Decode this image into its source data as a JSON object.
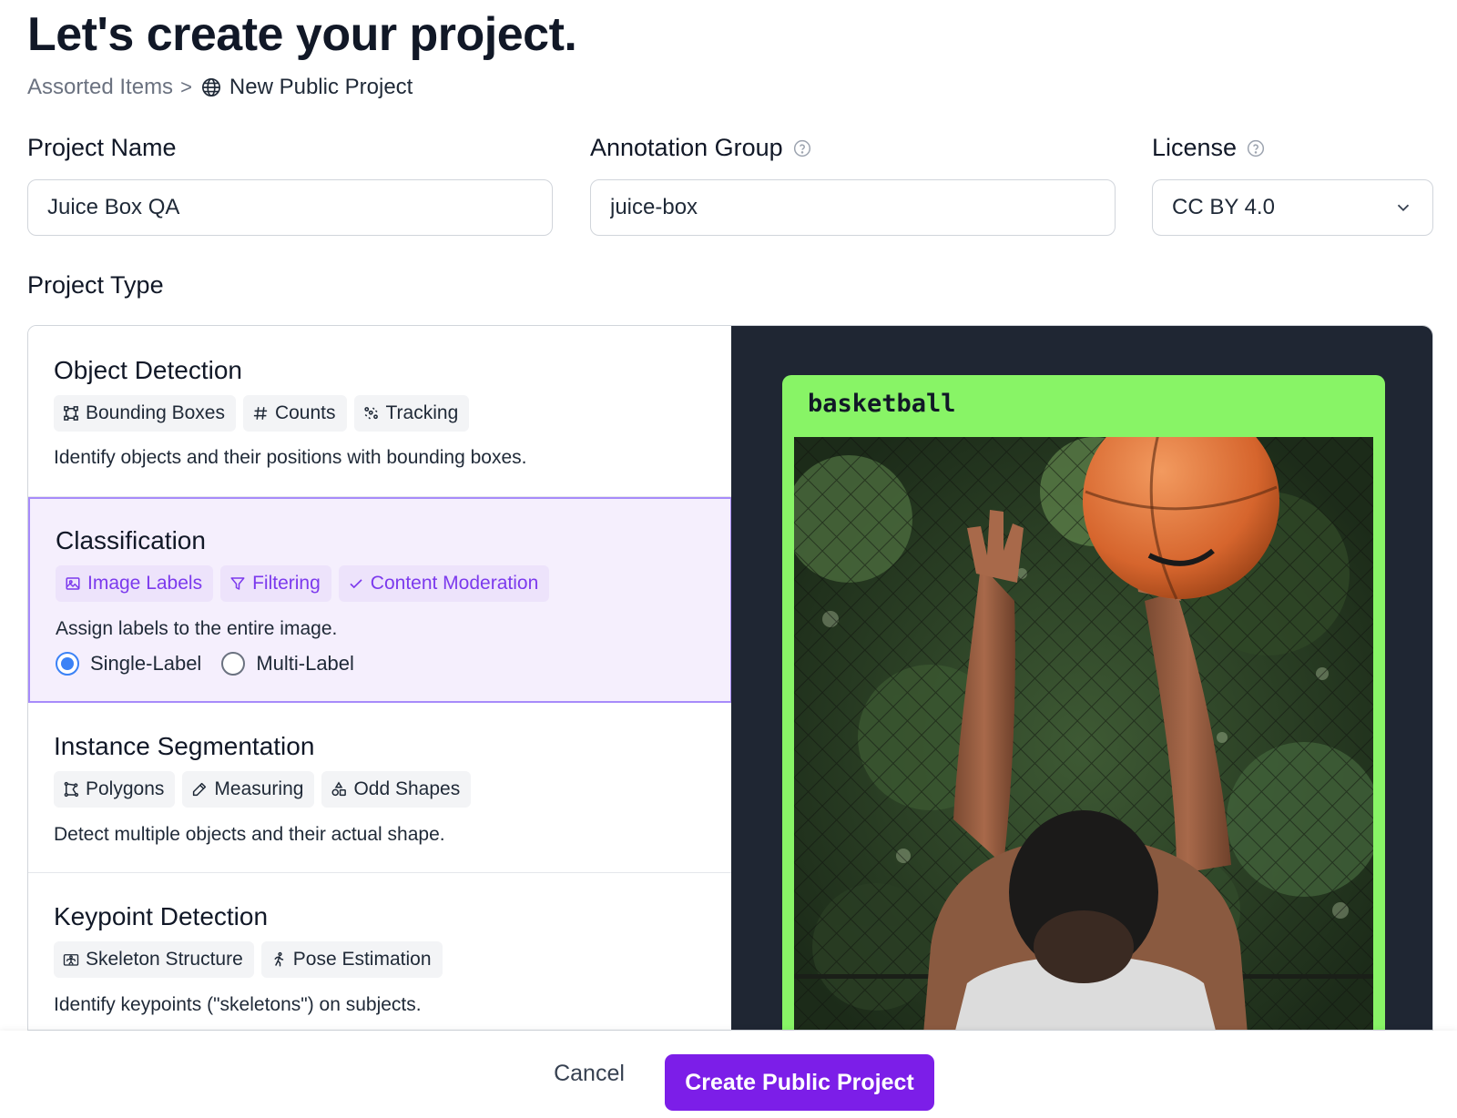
{
  "header": {
    "title": "Let's create your project.",
    "breadcrumb": {
      "parent": "Assorted Items",
      "separator": ">",
      "current": "New Public Project"
    }
  },
  "form": {
    "project_name": {
      "label": "Project Name",
      "value": "Juice Box QA"
    },
    "annotation_group": {
      "label": "Annotation Group",
      "value": "juice-box"
    },
    "license": {
      "label": "License",
      "value": "CC BY 4.0"
    }
  },
  "project_type": {
    "label": "Project Type",
    "types": [
      {
        "title": "Object Detection",
        "chips": [
          {
            "label": "Bounding Boxes",
            "icon": "bounding-box-icon"
          },
          {
            "label": "Counts",
            "icon": "hash-icon"
          },
          {
            "label": "Tracking",
            "icon": "tracking-icon"
          }
        ],
        "description": "Identify objects and their positions with bounding boxes."
      },
      {
        "title": "Classification",
        "selected": true,
        "chips": [
          {
            "label": "Image Labels",
            "icon": "image-icon"
          },
          {
            "label": "Filtering",
            "icon": "filter-icon"
          },
          {
            "label": "Content Moderation",
            "icon": "check-icon"
          }
        ],
        "description": "Assign labels to the entire image.",
        "options": [
          {
            "label": "Single-Label",
            "checked": true
          },
          {
            "label": "Multi-Label",
            "checked": false
          }
        ]
      },
      {
        "title": "Instance Segmentation",
        "chips": [
          {
            "label": "Polygons",
            "icon": "polygon-icon"
          },
          {
            "label": "Measuring",
            "icon": "ruler-icon"
          },
          {
            "label": "Odd Shapes",
            "icon": "shapes-icon"
          }
        ],
        "description": "Detect multiple objects and their actual shape."
      },
      {
        "title": "Keypoint Detection",
        "chips": [
          {
            "label": "Skeleton Structure",
            "icon": "skeleton-icon"
          },
          {
            "label": "Pose Estimation",
            "icon": "running-person-icon"
          }
        ],
        "description": "Identify keypoints (\"skeletons\") on subjects."
      }
    ]
  },
  "preview": {
    "label": "basketball"
  },
  "footer": {
    "cancel": "Cancel",
    "create": "Create Public Project"
  },
  "colors": {
    "accent": "#7c1ee8",
    "selected_bg": "#f5effd",
    "preview_bg": "#1f2633",
    "preview_frame": "#88f466"
  }
}
